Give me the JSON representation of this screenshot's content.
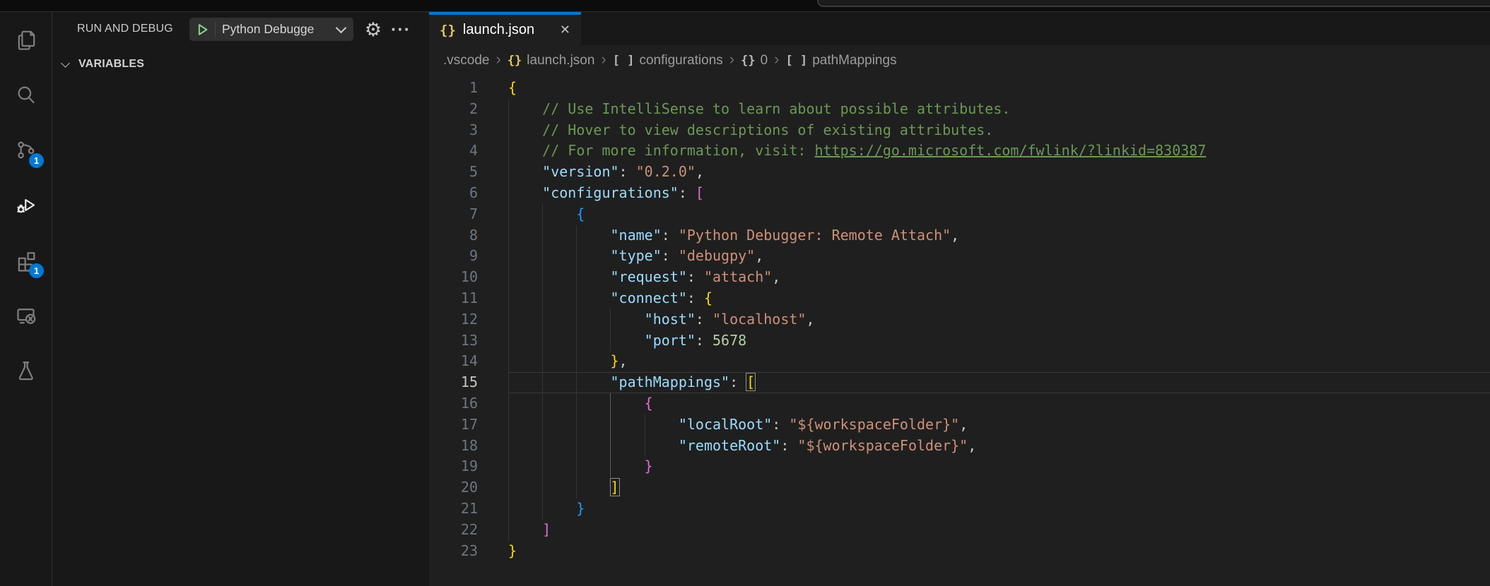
{
  "colors": {
    "accent_blue": "#0078d4",
    "badge_blue": "#0078d4",
    "play_green": "#89d185",
    "json_icon_yellow": "#e2c465",
    "bracket_gold": "#FFD700",
    "bracket_pink": "#DA70D6",
    "bracket_blue": "#179FFF",
    "key_blue": "#9CDCFE",
    "string_orange": "#CE9178",
    "number_green": "#B5CEA8",
    "comment_green": "#6A9955"
  },
  "activity_bar": {
    "items": [
      {
        "id": "explorer",
        "badge": ""
      },
      {
        "id": "search",
        "badge": ""
      },
      {
        "id": "source-control",
        "badge": "1"
      },
      {
        "id": "run-and-debug",
        "badge": "",
        "active": true
      },
      {
        "id": "extensions",
        "badge": "1"
      },
      {
        "id": "remote-explorer",
        "badge": ""
      },
      {
        "id": "testing",
        "badge": ""
      }
    ]
  },
  "sidebar": {
    "title": "RUN AND DEBUG",
    "config_picker": {
      "value": "Python Debugge"
    },
    "actions": {
      "settings": "⚙",
      "more": "···"
    },
    "sections": [
      {
        "label": "VARIABLES",
        "expanded": true
      }
    ]
  },
  "editor": {
    "tab": {
      "label": "launch.json",
      "icon": "{}",
      "close": "✕",
      "active": true
    },
    "breadcrumb": {
      "separator": "›",
      "items": [
        {
          "icon": "",
          "label": ".vscode"
        },
        {
          "icon": "{}",
          "icon_color": "yellow",
          "label": "launch.json"
        },
        {
          "icon": "[ ]",
          "label": "configurations"
        },
        {
          "icon": "{}",
          "label": "0"
        },
        {
          "icon": "[ ]",
          "label": "pathMappings"
        }
      ]
    }
  },
  "code": {
    "language": "json",
    "current_line": 15,
    "lines": [
      {
        "n": 1,
        "indent": 0,
        "seg": [
          [
            "b1",
            "{"
          ]
        ]
      },
      {
        "n": 2,
        "indent": 4,
        "seg": [
          [
            "cm",
            "// Use IntelliSense to learn about possible attributes."
          ]
        ]
      },
      {
        "n": 3,
        "indent": 4,
        "seg": [
          [
            "cm",
            "// Hover to view descriptions of existing attributes."
          ]
        ]
      },
      {
        "n": 4,
        "indent": 4,
        "seg": [
          [
            "cm",
            "// For more information, visit: "
          ],
          [
            "cm link",
            "https://go.microsoft.com/fwlink/?linkid=830387"
          ]
        ]
      },
      {
        "n": 5,
        "indent": 4,
        "seg": [
          [
            "key",
            "\"version\""
          ],
          [
            "pu",
            ": "
          ],
          [
            "str",
            "\"0.2.0\""
          ],
          [
            "pu",
            ","
          ]
        ]
      },
      {
        "n": 6,
        "indent": 4,
        "seg": [
          [
            "key",
            "\"configurations\""
          ],
          [
            "pu",
            ": "
          ],
          [
            "b2",
            "["
          ]
        ]
      },
      {
        "n": 7,
        "indent": 8,
        "seg": [
          [
            "b3",
            "{"
          ]
        ]
      },
      {
        "n": 8,
        "indent": 12,
        "seg": [
          [
            "key",
            "\"name\""
          ],
          [
            "pu",
            ": "
          ],
          [
            "str",
            "\"Python Debugger: Remote Attach\""
          ],
          [
            "pu",
            ","
          ]
        ]
      },
      {
        "n": 9,
        "indent": 12,
        "seg": [
          [
            "key",
            "\"type\""
          ],
          [
            "pu",
            ": "
          ],
          [
            "str",
            "\"debugpy\""
          ],
          [
            "pu",
            ","
          ]
        ]
      },
      {
        "n": 10,
        "indent": 12,
        "seg": [
          [
            "key",
            "\"request\""
          ],
          [
            "pu",
            ": "
          ],
          [
            "str",
            "\"attach\""
          ],
          [
            "pu",
            ","
          ]
        ]
      },
      {
        "n": 11,
        "indent": 12,
        "seg": [
          [
            "key",
            "\"connect\""
          ],
          [
            "pu",
            ": "
          ],
          [
            "b1",
            "{"
          ]
        ]
      },
      {
        "n": 12,
        "indent": 16,
        "seg": [
          [
            "key",
            "\"host\""
          ],
          [
            "pu",
            ": "
          ],
          [
            "str",
            "\"localhost\""
          ],
          [
            "pu",
            ","
          ]
        ]
      },
      {
        "n": 13,
        "indent": 16,
        "seg": [
          [
            "key",
            "\"port\""
          ],
          [
            "pu",
            ": "
          ],
          [
            "num",
            "5678"
          ]
        ]
      },
      {
        "n": 14,
        "indent": 12,
        "seg": [
          [
            "b1",
            "}"
          ],
          [
            "pu",
            ","
          ]
        ]
      },
      {
        "n": 15,
        "indent": 12,
        "cur": true,
        "seg": [
          [
            "key",
            "\"pathMappings\""
          ],
          [
            "pu",
            ": "
          ],
          [
            "b1 match",
            "["
          ]
        ]
      },
      {
        "n": 16,
        "indent": 16,
        "ag": 12,
        "seg": [
          [
            "b2",
            "{"
          ]
        ]
      },
      {
        "n": 17,
        "indent": 20,
        "ag": 12,
        "seg": [
          [
            "key",
            "\"localRoot\""
          ],
          [
            "pu",
            ": "
          ],
          [
            "str",
            "\"${workspaceFolder}\""
          ],
          [
            "pu",
            ","
          ]
        ]
      },
      {
        "n": 18,
        "indent": 20,
        "ag": 12,
        "seg": [
          [
            "key",
            "\"remoteRoot\""
          ],
          [
            "pu",
            ": "
          ],
          [
            "str",
            "\"${workspaceFolder}\""
          ],
          [
            "pu",
            ","
          ]
        ]
      },
      {
        "n": 19,
        "indent": 16,
        "ag": 12,
        "seg": [
          [
            "b2",
            "}"
          ]
        ]
      },
      {
        "n": 20,
        "indent": 12,
        "ag": 12,
        "seg": [
          [
            "b1 match",
            "]"
          ]
        ]
      },
      {
        "n": 21,
        "indent": 8,
        "seg": [
          [
            "b3",
            "}"
          ]
        ]
      },
      {
        "n": 22,
        "indent": 4,
        "seg": [
          [
            "b2",
            "]"
          ]
        ]
      },
      {
        "n": 23,
        "indent": 0,
        "seg": [
          [
            "b1",
            "}"
          ]
        ]
      }
    ]
  }
}
